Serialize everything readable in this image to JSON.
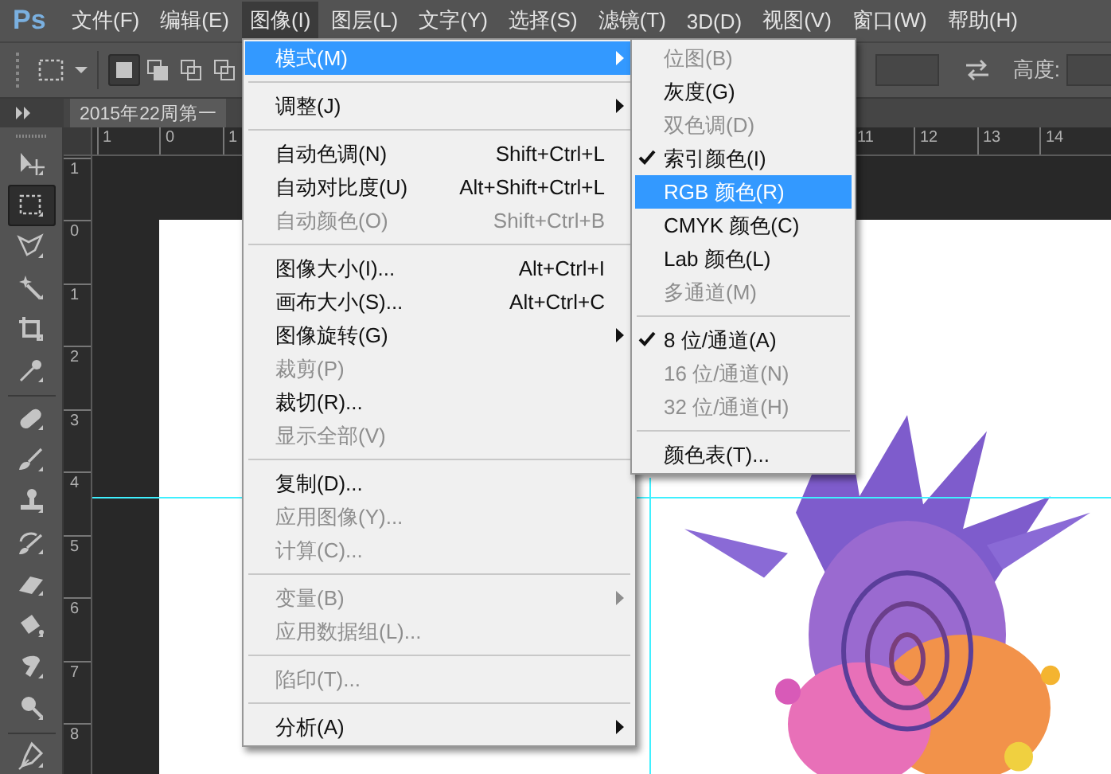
{
  "menu_bar": {
    "logo": "Ps",
    "items": [
      {
        "label": "文件(F)",
        "selected": false
      },
      {
        "label": "编辑(E)",
        "selected": false
      },
      {
        "label": "图像(I)",
        "selected": true
      },
      {
        "label": "图层(L)",
        "selected": false
      },
      {
        "label": "文字(Y)",
        "selected": false
      },
      {
        "label": "选择(S)",
        "selected": false
      },
      {
        "label": "滤镜(T)",
        "selected": false
      },
      {
        "label": "3D(D)",
        "selected": false
      },
      {
        "label": "视图(V)",
        "selected": false
      },
      {
        "label": "窗口(W)",
        "selected": false
      },
      {
        "label": "帮助(H)",
        "selected": false
      }
    ]
  },
  "options_bar": {
    "modes": [
      {
        "selected": true
      },
      {
        "selected": false
      },
      {
        "selected": false
      },
      {
        "selected": false
      }
    ],
    "height_label": "高度:"
  },
  "document_tab": {
    "title": "2015年22周第一"
  },
  "top_ruler": {
    "start_labels": [
      "1",
      "0",
      "1"
    ],
    "end_labels": [
      "11",
      "12",
      "13",
      "14"
    ]
  },
  "left_ruler": {
    "labels": [
      "1",
      "0",
      "1",
      "2",
      "3",
      "4",
      "5",
      "6",
      "7",
      "8"
    ]
  },
  "tool_groups": [
    {
      "tools": [
        {
          "kind": "move",
          "selected": false
        },
        {
          "kind": "marquee",
          "selected": true
        },
        {
          "kind": "lasso",
          "selected": false
        },
        {
          "kind": "wand",
          "selected": false
        },
        {
          "kind": "crop",
          "selected": false
        },
        {
          "kind": "eyedropper",
          "selected": false
        }
      ]
    },
    {
      "tools": [
        {
          "kind": "heal",
          "selected": false
        },
        {
          "kind": "brush",
          "selected": false
        },
        {
          "kind": "stamp",
          "selected": false
        },
        {
          "kind": "history",
          "selected": false
        },
        {
          "kind": "eraser",
          "selected": false
        },
        {
          "kind": "bucket",
          "selected": false
        },
        {
          "kind": "smudge",
          "selected": false
        },
        {
          "kind": "dodge",
          "selected": false
        }
      ]
    },
    {
      "tools": [
        {
          "kind": "pen",
          "selected": false
        }
      ]
    }
  ],
  "image_menu": {
    "groups": [
      {
        "items": [
          {
            "label": "模式(M)",
            "disabled": false,
            "submenu": true,
            "selected": true
          }
        ]
      },
      {
        "items": [
          {
            "label": "调整(J)",
            "disabled": false,
            "submenu": true,
            "selected": false
          }
        ]
      },
      {
        "items": [
          {
            "label": "自动色调(N)",
            "shortcut": "Shift+Ctrl+L",
            "disabled": false,
            "submenu": false,
            "selected": false
          },
          {
            "label": "自动对比度(U)",
            "shortcut": "Alt+Shift+Ctrl+L",
            "disabled": false,
            "submenu": false,
            "selected": false
          },
          {
            "label": "自动颜色(O)",
            "shortcut": "Shift+Ctrl+B",
            "disabled": true,
            "submenu": false,
            "selected": false
          }
        ]
      },
      {
        "items": [
          {
            "label": "图像大小(I)...",
            "shortcut": "Alt+Ctrl+I",
            "disabled": false,
            "submenu": false,
            "selected": false
          },
          {
            "label": "画布大小(S)...",
            "shortcut": "Alt+Ctrl+C",
            "disabled": false,
            "submenu": false,
            "selected": false
          },
          {
            "label": "图像旋转(G)",
            "disabled": false,
            "submenu": true,
            "selected": false
          },
          {
            "label": "裁剪(P)",
            "disabled": true,
            "submenu": false,
            "selected": false
          },
          {
            "label": "裁切(R)...",
            "disabled": false,
            "submenu": false,
            "selected": false
          },
          {
            "label": "显示全部(V)",
            "disabled": true,
            "submenu": false,
            "selected": false
          }
        ]
      },
      {
        "items": [
          {
            "label": "复制(D)...",
            "disabled": false,
            "submenu": false,
            "selected": false
          },
          {
            "label": "应用图像(Y)...",
            "disabled": true,
            "submenu": false,
            "selected": false
          },
          {
            "label": "计算(C)...",
            "disabled": true,
            "submenu": false,
            "selected": false
          }
        ]
      },
      {
        "items": [
          {
            "label": "变量(B)",
            "disabled": true,
            "submenu": true,
            "selected": false
          },
          {
            "label": "应用数据组(L)...",
            "disabled": true,
            "submenu": false,
            "selected": false
          }
        ]
      },
      {
        "items": [
          {
            "label": "陷印(T)...",
            "disabled": true,
            "submenu": false,
            "selected": false
          }
        ]
      },
      {
        "items": [
          {
            "label": "分析(A)",
            "disabled": false,
            "submenu": true,
            "selected": false
          }
        ]
      }
    ]
  },
  "mode_submenu": {
    "groups": [
      {
        "items": [
          {
            "label": "位图(B)",
            "checked": false,
            "disabled": true,
            "selected": false
          },
          {
            "label": "灰度(G)",
            "checked": false,
            "disabled": false,
            "selected": false
          },
          {
            "label": "双色调(D)",
            "checked": false,
            "disabled": true,
            "selected": false
          },
          {
            "label": "索引颜色(I)",
            "checked": true,
            "disabled": false,
            "selected": false
          },
          {
            "label": "RGB 颜色(R)",
            "checked": false,
            "disabled": false,
            "selected": true
          },
          {
            "label": "CMYK 颜色(C)",
            "checked": false,
            "disabled": false,
            "selected": false
          },
          {
            "label": "Lab 颜色(L)",
            "checked": false,
            "disabled": false,
            "selected": false
          },
          {
            "label": "多通道(M)",
            "checked": false,
            "disabled": true,
            "selected": false
          }
        ]
      },
      {
        "items": [
          {
            "label": "8 位/通道(A)",
            "checked": true,
            "disabled": false,
            "selected": false
          },
          {
            "label": "16 位/通道(N)",
            "checked": false,
            "disabled": true,
            "selected": false
          },
          {
            "label": "32 位/通道(H)",
            "checked": false,
            "disabled": true,
            "selected": false
          }
        ]
      },
      {
        "items": [
          {
            "label": "颜色表(T)...",
            "checked": false,
            "disabled": false,
            "selected": false
          }
        ]
      }
    ]
  }
}
